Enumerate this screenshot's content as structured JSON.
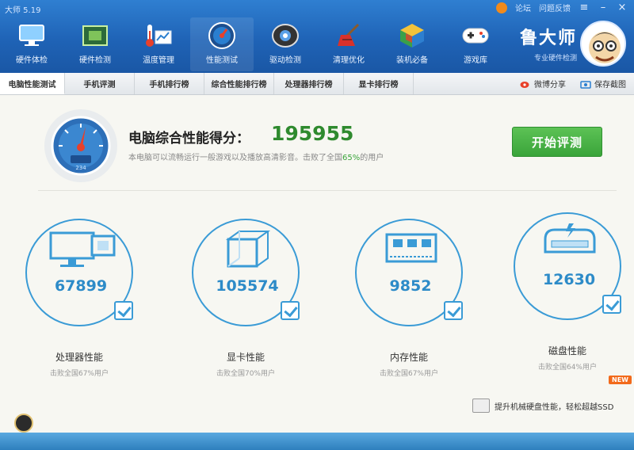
{
  "window": {
    "title": "大师 5.19",
    "controls": [
      "论坛",
      "问题反馈"
    ]
  },
  "nav": [
    {
      "label": "硬件体检",
      "icon": "monitor-icon"
    },
    {
      "label": "硬件检测",
      "icon": "chip-icon"
    },
    {
      "label": "温度管理",
      "icon": "thermometer-icon"
    },
    {
      "label": "性能测试",
      "icon": "speedometer-icon",
      "active": true
    },
    {
      "label": "驱动检测",
      "icon": "driver-icon"
    },
    {
      "label": "清理优化",
      "icon": "broom-icon"
    },
    {
      "label": "装机必备",
      "icon": "cube-icon"
    },
    {
      "label": "游戏库",
      "icon": "gamepad-icon"
    }
  ],
  "brand": {
    "name": "鲁大师",
    "slogan": "专业硬件检测"
  },
  "tabs": [
    {
      "label": "电脑性能测试",
      "active": true
    },
    {
      "label": "手机评测"
    },
    {
      "label": "手机排行榜"
    },
    {
      "label": "综合性能排行榜"
    },
    {
      "label": "处理器排行榜"
    },
    {
      "label": "显卡排行榜"
    }
  ],
  "tab_actions": {
    "share": "微博分享",
    "save": "保存截图"
  },
  "score": {
    "title": "电脑综合性能得分：",
    "value": "195955",
    "desc_prefix": "本电脑可以流畅运行一般游戏以及播放高清影音。击败了全国",
    "desc_pct": "65%",
    "desc_suffix": "的用户",
    "gauge_readout": "234"
  },
  "start_button": "开始评测",
  "cards": [
    {
      "name": "处理器性能",
      "value": "67899",
      "sub": "击败全国67%用户",
      "icon": "cpu-monitor-icon"
    },
    {
      "name": "显卡性能",
      "value": "105574",
      "sub": "击败全国70%用户",
      "icon": "gpu-cube-icon"
    },
    {
      "name": "内存性能",
      "value": "9852",
      "sub": "击败全国67%用户",
      "icon": "memory-icon"
    },
    {
      "name": "磁盘性能",
      "value": "12630",
      "sub": "击败全国64%用户",
      "icon": "disk-icon"
    }
  ],
  "ssd_tip": "提升机械硬盘性能，轻松超越SSD",
  "new_badge": "NEW",
  "colors": {
    "header": "#1f63b6",
    "accent": "#3a9bd6",
    "score": "#2e8a2e",
    "button": "#3aa43a"
  }
}
